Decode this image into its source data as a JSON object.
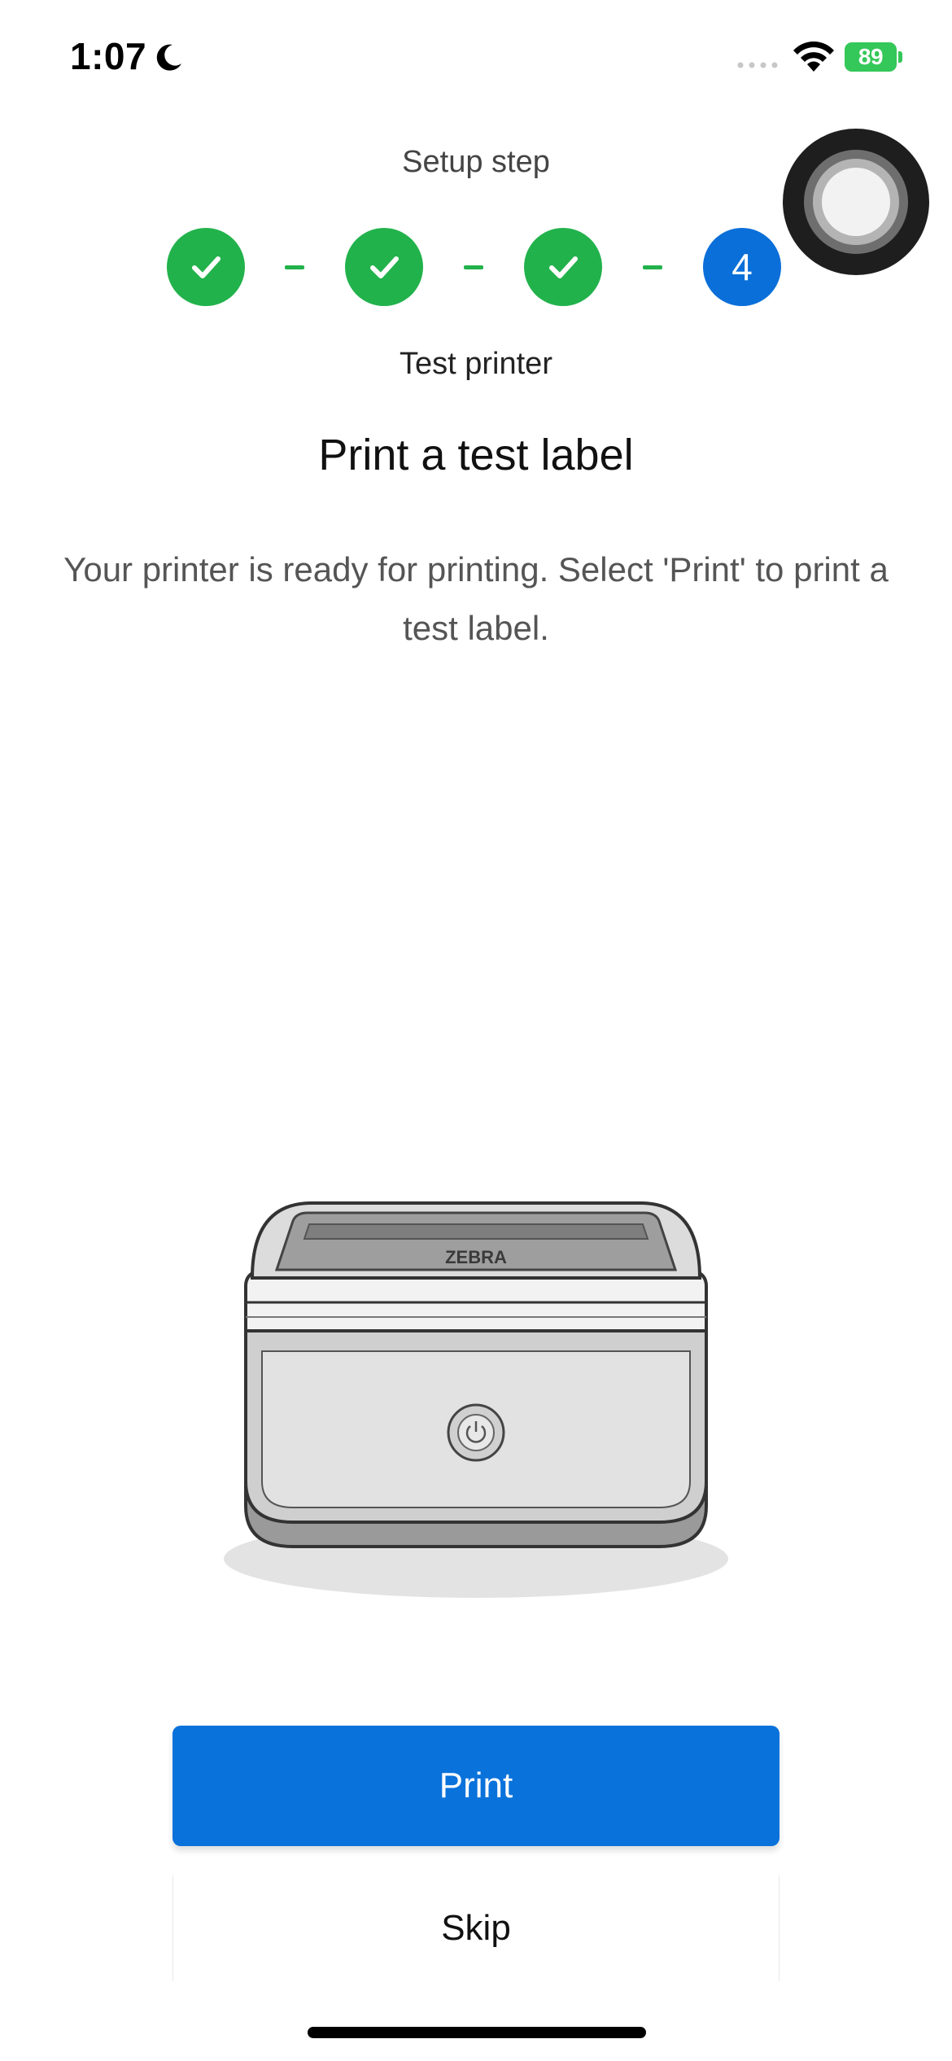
{
  "status_bar": {
    "time": "1:07",
    "battery_level": "89",
    "icons": [
      "moon-icon",
      "signal-icon",
      "wifi-icon",
      "battery-icon"
    ]
  },
  "setup": {
    "heading": "Setup step",
    "steps": [
      {
        "state": "done",
        "icon": "checkmark-icon"
      },
      {
        "state": "done",
        "icon": "checkmark-icon"
      },
      {
        "state": "done",
        "icon": "checkmark-icon"
      },
      {
        "state": "current",
        "number": "4"
      }
    ],
    "current_step_caption": "Test printer"
  },
  "main": {
    "title": "Print a test label",
    "description": "Your printer is ready for printing. Select 'Print' to print a test label.",
    "illustration": {
      "icon": "printer-illustration",
      "brand_text": "ZEBRA"
    }
  },
  "actions": {
    "print_label": "Print",
    "skip_label": "Skip"
  },
  "colors": {
    "primary": "#0a72db",
    "success": "#22b24c",
    "text_muted": "#555555"
  }
}
